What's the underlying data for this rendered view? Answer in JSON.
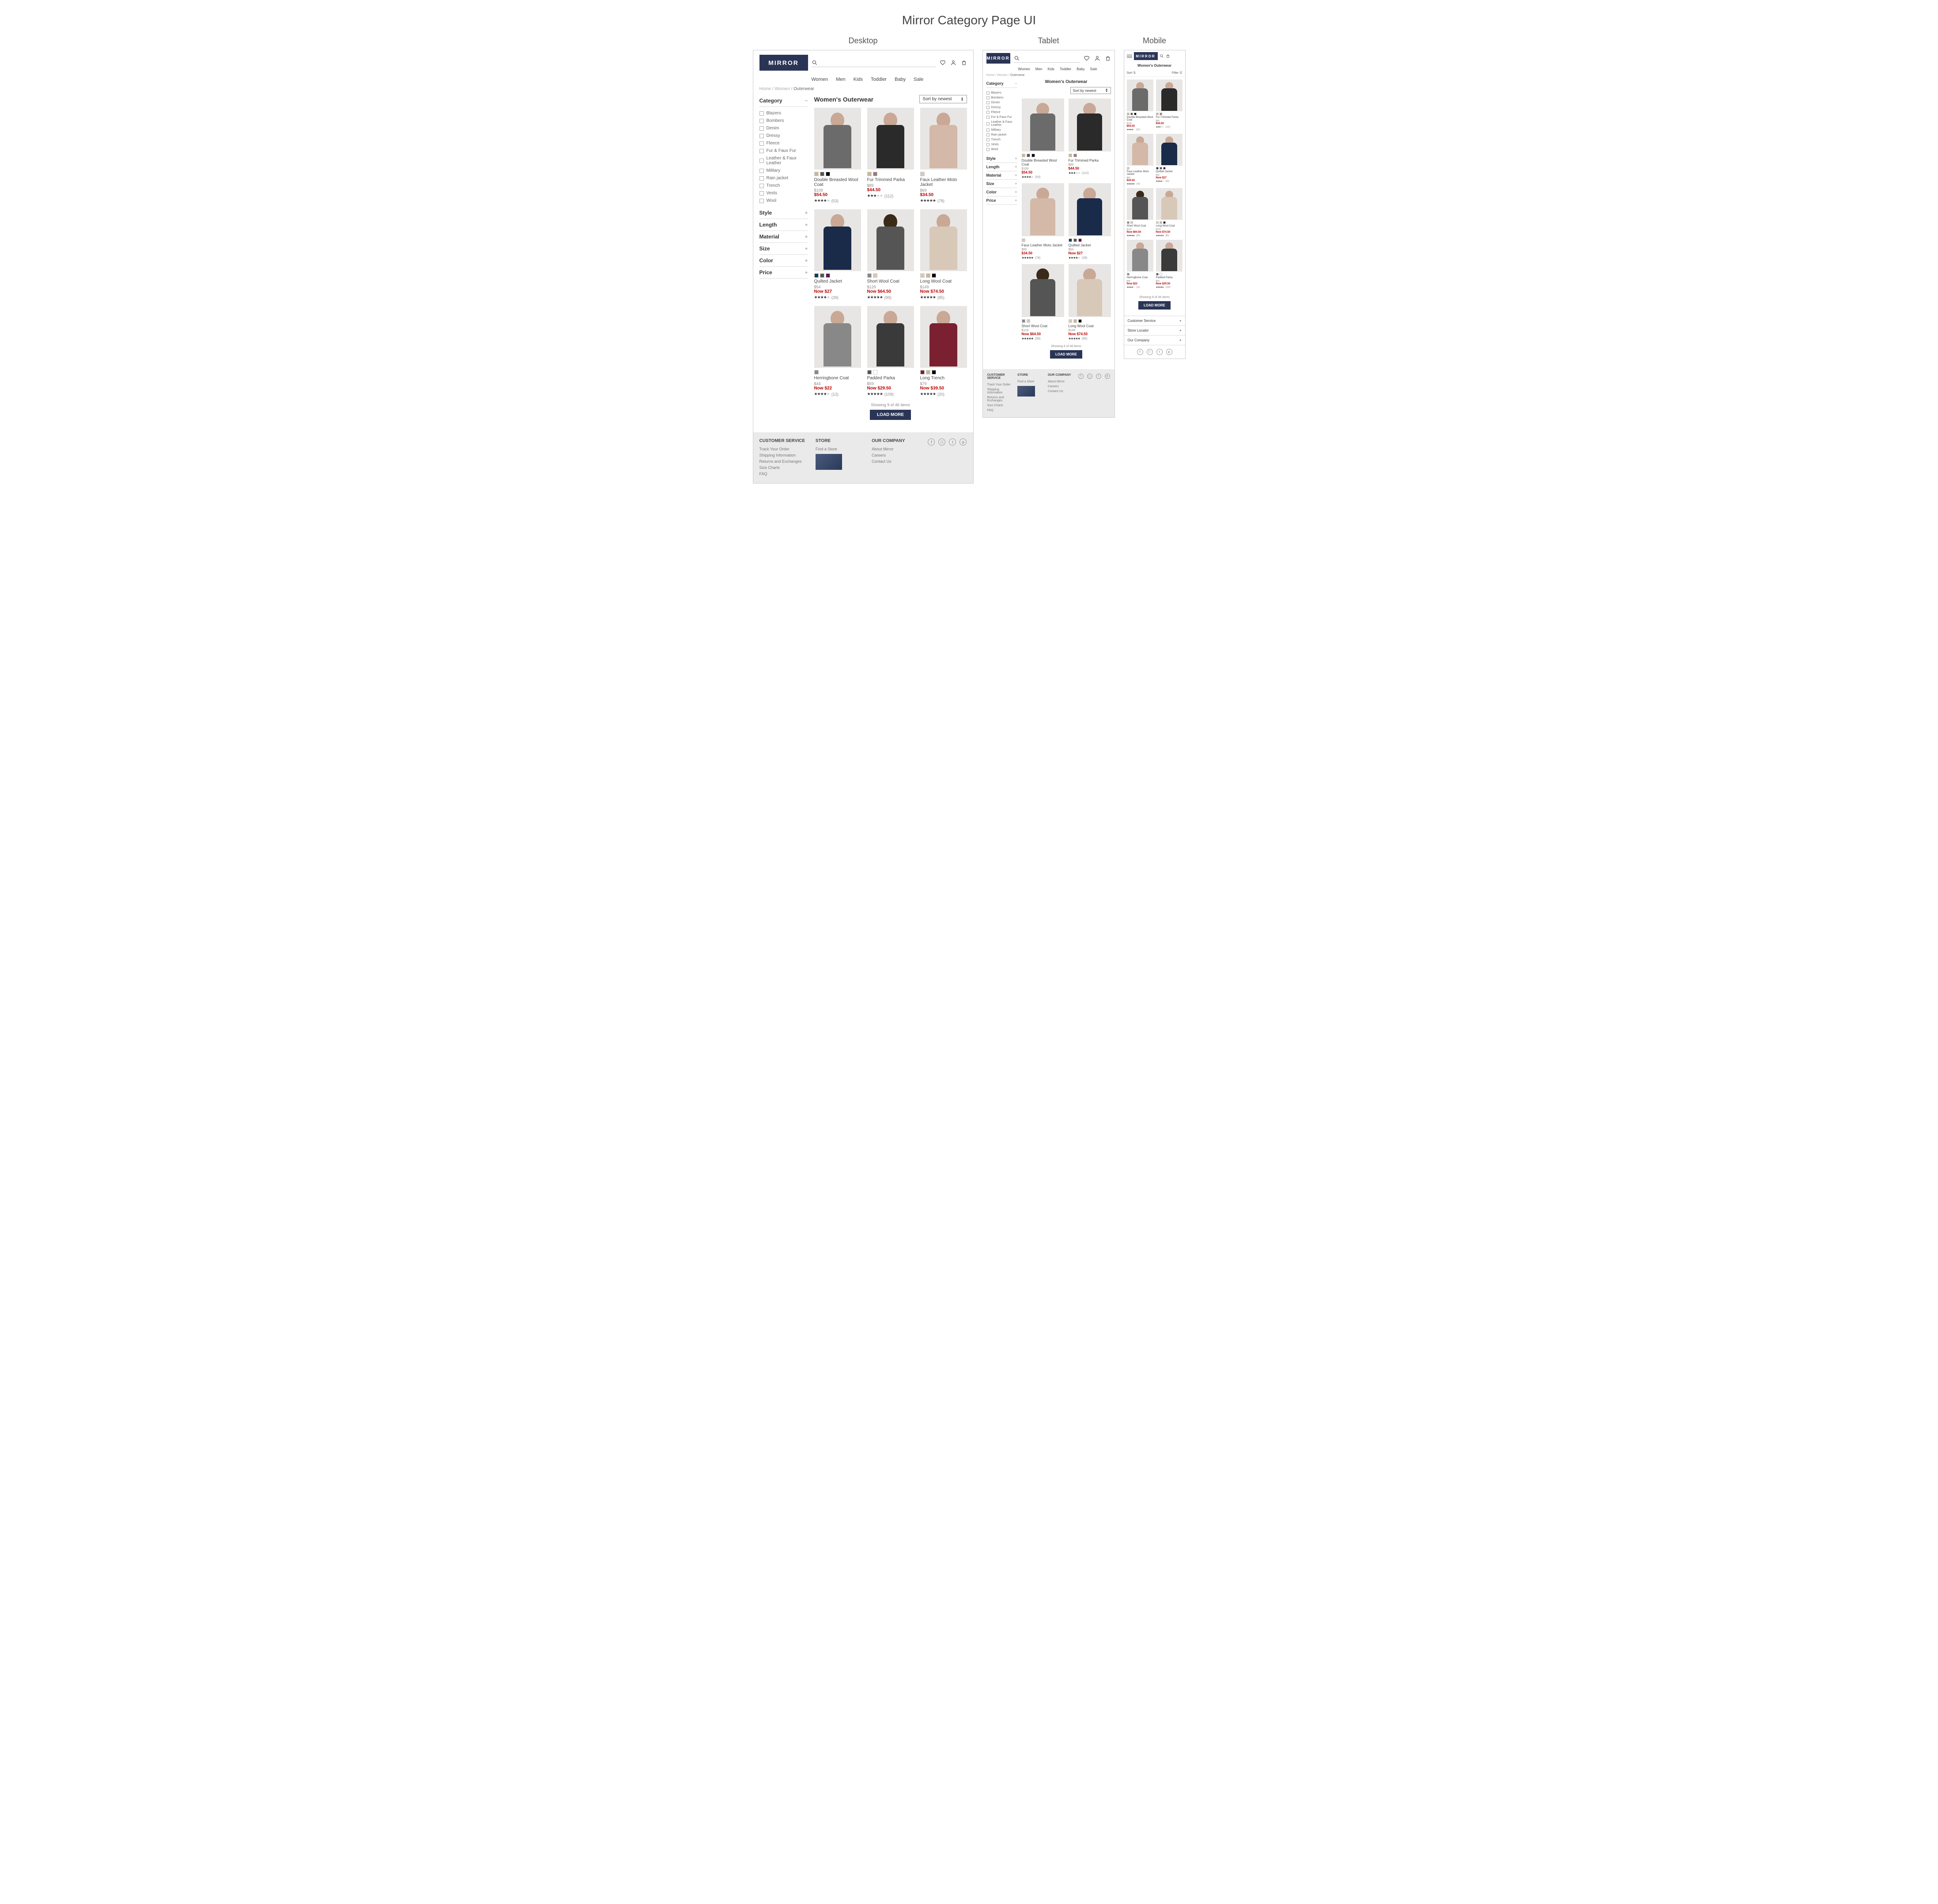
{
  "page_title": "Mirror Category Page UI",
  "layouts": {
    "desktop": "Desktop",
    "tablet": "Tablet",
    "mobile": "Mobile"
  },
  "brand": "MIRROR",
  "nav": [
    "Women",
    "Men",
    "Kids",
    "Toddler",
    "Baby",
    "Sale"
  ],
  "breadcrumb": {
    "items": [
      "Home",
      "Women"
    ],
    "current": "Outerwear"
  },
  "category_title": "Women's Outerwear",
  "sort_label": "Sort by newest",
  "mobile_sort": "Sort",
  "mobile_filter": "Filter",
  "filters": {
    "category": {
      "label": "Category",
      "open": true,
      "items": [
        "Blazers",
        "Bombers",
        "Denim",
        "Dressy",
        "Fleece",
        "Fur & Faux Fur",
        "Leather & Faux Leather",
        "Military",
        "Rain jacket",
        "Trench",
        "Vests",
        "Wool"
      ]
    },
    "collapsed": [
      "Style",
      "Length",
      "Material",
      "Size",
      "Color",
      "Price"
    ]
  },
  "products": [
    {
      "name": "Double Breasted Wool Coat",
      "old": "$109",
      "price": "$54.50",
      "stars": 4,
      "reviews": "(53)",
      "swatches": [
        "#c9b896",
        "#555",
        "#000"
      ],
      "img": "c1"
    },
    {
      "name": "Fur Trimmed Parka",
      "old": "$89",
      "price": "$44.50",
      "stars": 3,
      "reviews": "(112)",
      "swatches": [
        "#c9b896",
        "#9b7878"
      ],
      "img": "c2"
    },
    {
      "name": "Faux Leather Moto Jacket",
      "old": "$69",
      "price": "$34.50",
      "stars": 5,
      "reviews": "(78)",
      "swatches": [
        "#d8c8b8"
      ],
      "img": "c3"
    },
    {
      "name": "Quilted Jacket",
      "old": "$54",
      "price": "Now $27",
      "stars": 4,
      "reviews": "(39)",
      "swatches": [
        "#1a3a5a",
        "#555",
        "#5a1a4a"
      ],
      "img": "c4"
    },
    {
      "name": "Short Wool Coat",
      "old": "$129",
      "price": "Now $64.50",
      "stars": 5,
      "reviews": "(99)",
      "swatches": [
        "#888",
        "#d8c8b8"
      ],
      "img": "c5 s2"
    },
    {
      "name": "Long Wool Coat",
      "old": "$149",
      "price": "Now $74.50",
      "stars": 5,
      "reviews": "(85)",
      "swatches": [
        "#d8c8b8",
        "#c9b896",
        "#000"
      ],
      "img": "c6"
    },
    {
      "name": "Herringbone Coat",
      "old": "$44",
      "price": "Now $22",
      "stars": 4,
      "reviews": "(12)",
      "swatches": [
        "#888"
      ],
      "img": "c7"
    },
    {
      "name": "Padded Parka",
      "old": "$59",
      "price": "Now $29.50",
      "stars": 5,
      "reviews": "(109)",
      "swatches": [
        "#555",
        "#fff"
      ],
      "img": "c8"
    },
    {
      "name": "Long Trench",
      "old": "$79",
      "price": "Now $39.50",
      "stars": 5,
      "reviews": "(20)",
      "swatches": [
        "#7a2030",
        "#c9b896",
        "#000"
      ],
      "img": "c9"
    }
  ],
  "showing": {
    "desktop": "Showing 9 of 46 items",
    "tablet": "Showing 6 of 46 items",
    "mobile": "Showing 8 of 46 items"
  },
  "load_more": "LOAD MORE",
  "footer": {
    "customer_service": {
      "label": "CUSTOMER SERVICE",
      "items": [
        "Track Your Order",
        "Shipping Information",
        "Returns and Exchanges",
        "Size Charts",
        "FAQ"
      ]
    },
    "store": {
      "label": "STORE",
      "items": [
        "Find a Store"
      ]
    },
    "company": {
      "label": "OUR COMPANY",
      "items": [
        "About Mirror",
        "Careers",
        "Contact Us"
      ]
    },
    "social": [
      "f",
      "ⓘ",
      "t",
      "p"
    ]
  },
  "mfooter": [
    "Customer Service",
    "Store Locator",
    "Our Company"
  ]
}
